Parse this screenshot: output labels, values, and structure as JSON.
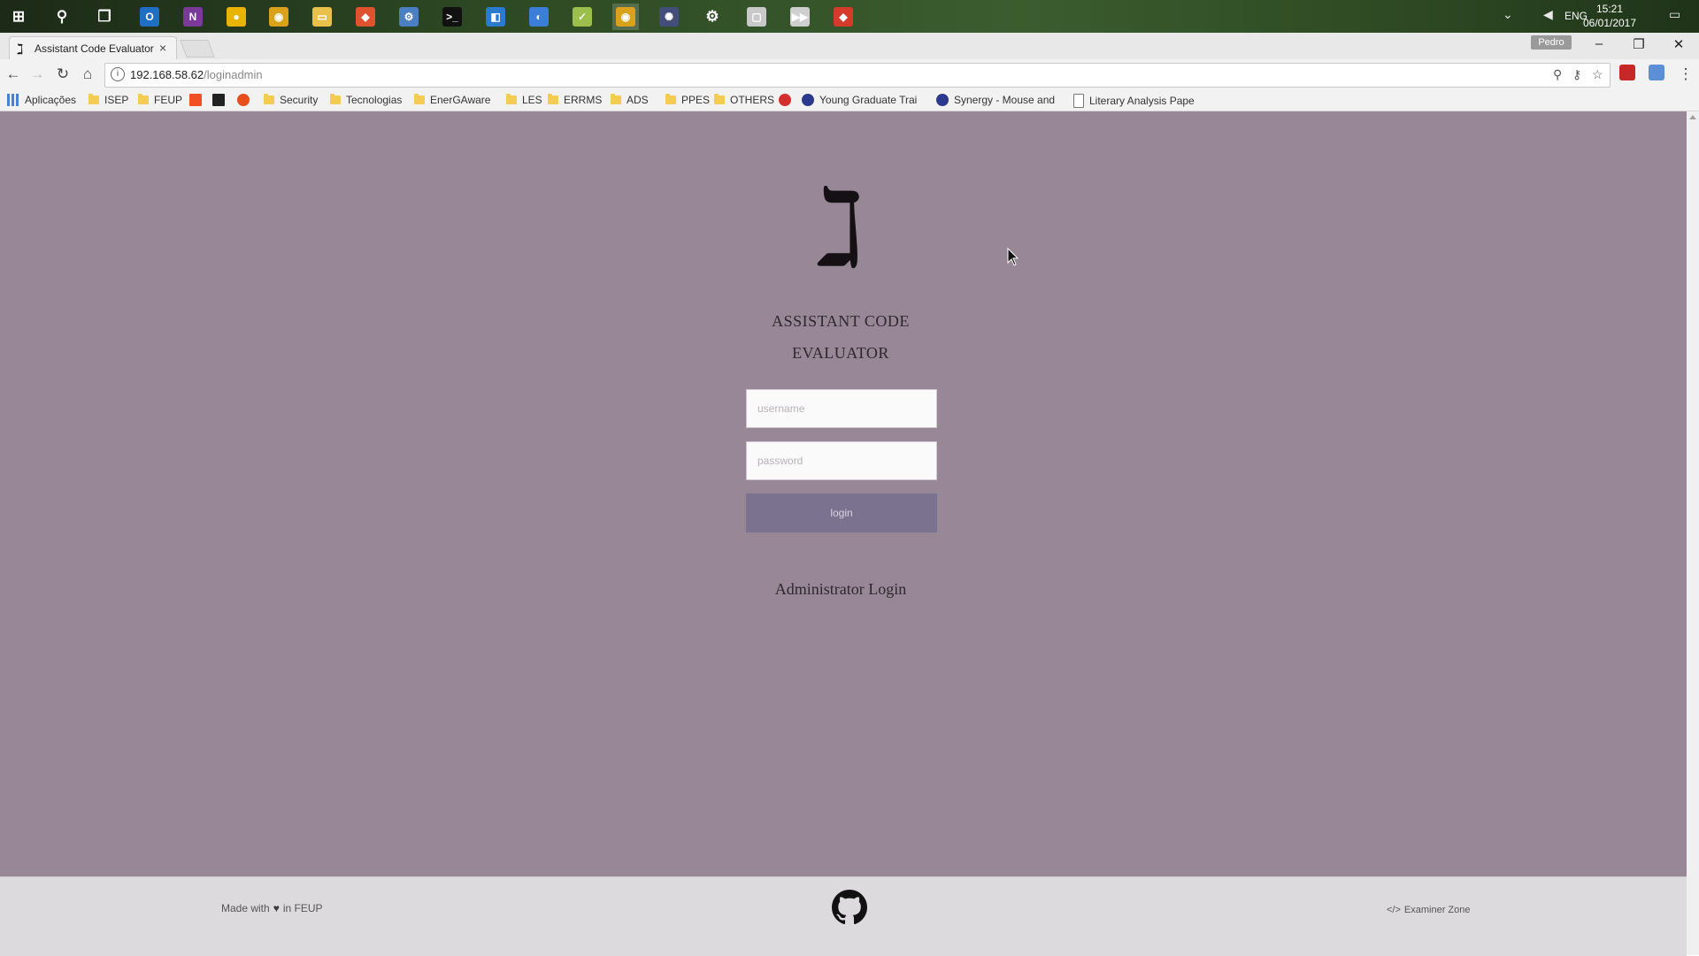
{
  "taskbar": {
    "apps": [
      {
        "name": "windows-start-icon",
        "color": "#ffffff",
        "glyph": "⊞"
      },
      {
        "name": "search-icon",
        "color": "#ffffff",
        "glyph": "⚲"
      },
      {
        "name": "task-view-icon",
        "color": "#ffffff",
        "glyph": "❐"
      },
      {
        "name": "outlook-icon",
        "color": "#1f6fc4",
        "glyph": "O"
      },
      {
        "name": "onenote-icon",
        "color": "#7a3a9a",
        "glyph": "N"
      },
      {
        "name": "yellow-app-icon",
        "color": "#e8b400",
        "glyph": "●"
      },
      {
        "name": "chrome-icon",
        "color": "#d9a21a",
        "glyph": "◉"
      },
      {
        "name": "file-explorer-icon",
        "color": "#e8c04a",
        "glyph": "▭"
      },
      {
        "name": "git-app-icon",
        "color": "#e0522c",
        "glyph": "◆"
      },
      {
        "name": "network-tool-icon",
        "color": "#4a7fc4",
        "glyph": "⚙"
      },
      {
        "name": "terminal-icon",
        "color": "#111111",
        "glyph": ">_"
      },
      {
        "name": "vscode-icon",
        "color": "#2a7ad0",
        "glyph": "◧"
      },
      {
        "name": "browser-app-icon",
        "color": "#3b7ed8",
        "glyph": "◐"
      },
      {
        "name": "notes-app-icon",
        "color": "#9bbf4a",
        "glyph": "✓"
      },
      {
        "name": "chrome-active-icon",
        "color": "#d9a21a",
        "glyph": "◉"
      },
      {
        "name": "globe-app-icon",
        "color": "#444e7a",
        "glyph": "✺"
      },
      {
        "name": "settings-icon",
        "color": "#ffffff",
        "glyph": "⚙"
      },
      {
        "name": "window-app-icon",
        "color": "#c9c9c9",
        "glyph": "▢"
      },
      {
        "name": "media-app-icon",
        "color": "#cfcfcf",
        "glyph": "▶▶"
      },
      {
        "name": "red-app-icon",
        "color": "#d63a2a",
        "glyph": "◆"
      }
    ],
    "lang": "ENG",
    "time": "15:21",
    "date": "06/01/2017"
  },
  "browser": {
    "tab_title": "Assistant Code Evaluator",
    "tab_favicon": "ℷ",
    "profile": "Pedro",
    "url_host": "192.168.58.62",
    "url_path": "/loginadmin",
    "bookmarks": [
      {
        "label": "Aplicações",
        "type": "apps"
      },
      {
        "label": "ISEP",
        "type": "folder"
      },
      {
        "label": "FEUP",
        "type": "folder"
      },
      {
        "label": "",
        "type": "ms-icon"
      },
      {
        "label": "",
        "type": "black-icon"
      },
      {
        "label": "",
        "type": "orange-icon"
      },
      {
        "label": "Security",
        "type": "folder"
      },
      {
        "label": "Tecnologias",
        "type": "folder"
      },
      {
        "label": "EnerGAware",
        "type": "folder"
      },
      {
        "label": "LES",
        "type": "folder"
      },
      {
        "label": "ERRMS",
        "type": "folder"
      },
      {
        "label": "ADS",
        "type": "folder"
      },
      {
        "label": "PPES",
        "type": "folder"
      },
      {
        "label": "OTHERS",
        "type": "folder"
      },
      {
        "label": "",
        "type": "red-icon"
      },
      {
        "label": "Young Graduate Trai",
        "type": "site"
      },
      {
        "label": "Synergy - Mouse and",
        "type": "site"
      },
      {
        "label": "Literary Analysis Pape",
        "type": "page"
      }
    ]
  },
  "page": {
    "logo_glyph": "ℷ",
    "title_line1": "ASSISTANT CODE",
    "title_line2": "EVALUATOR",
    "username_placeholder": "username",
    "password_placeholder": "password",
    "login_label": "login",
    "admin_label": "Administrator Login",
    "colors": {
      "background": "#978797",
      "button": "#7b7290",
      "footer": "#dcdadc"
    }
  },
  "footer": {
    "made_prefix": "Made with",
    "made_suffix": "in FEUP",
    "examiner": "Examiner Zone",
    "examiner_icon": "</>"
  }
}
